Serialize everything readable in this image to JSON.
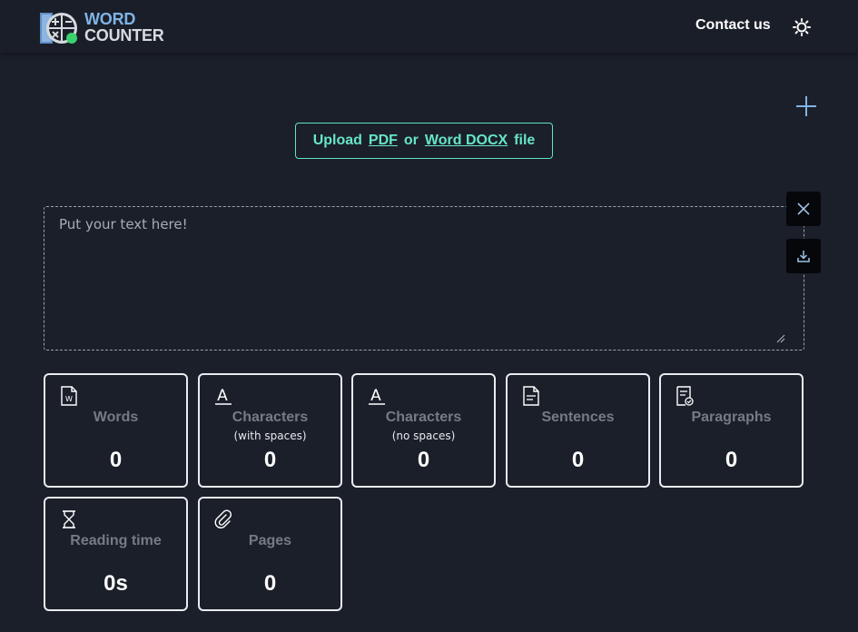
{
  "header": {
    "logo_line1": "WORD",
    "logo_line2": "COUNTER",
    "contact_label": "Contact us"
  },
  "upload": {
    "prefix": "Upload",
    "pdf_label": "PDF",
    "or_label": "or",
    "docx_label": "Word DOCX",
    "suffix": "file"
  },
  "editor": {
    "placeholder": "Put your text here!",
    "value": ""
  },
  "stats": [
    {
      "label": "Words",
      "sub": "",
      "value": "0",
      "icon": "word-document-icon"
    },
    {
      "label": "Characters",
      "sub": "(with spaces)",
      "value": "0",
      "icon": "letter-a-icon"
    },
    {
      "label": "Characters",
      "sub": "(no spaces)",
      "value": "0",
      "icon": "letter-a-icon"
    },
    {
      "label": "Sentences",
      "sub": "",
      "value": "0",
      "icon": "document-lines-icon"
    },
    {
      "label": "Paragraphs",
      "sub": "",
      "value": "0",
      "icon": "document-check-icon"
    },
    {
      "label": "Reading time",
      "sub": "",
      "value": "0s",
      "icon": "hourglass-icon"
    },
    {
      "label": "Pages",
      "sub": "",
      "value": "0",
      "icon": "paperclip-icon"
    }
  ],
  "colors": {
    "background": "#1b1f2a",
    "accent": "#66e6c4",
    "logo_blue": "#7fb4e6",
    "card_border": "#e9ecef",
    "label_gray": "#767b83"
  }
}
